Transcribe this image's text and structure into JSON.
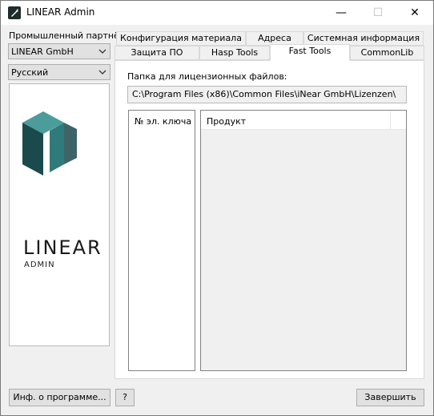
{
  "window": {
    "title": "LINEAR Admin",
    "minimize": "—",
    "maximize": "☐",
    "close": "✕"
  },
  "sidebar": {
    "partner_label": "Промышленный партнёр",
    "partner_value": "LINEAR GmbH",
    "language_value": "Русский",
    "logo": {
      "word": "LINEAR",
      "sub": "ADMIN",
      "colors": [
        "#1b4a4c",
        "#2f7a7b",
        "#4c9c9b"
      ]
    }
  },
  "tabs": {
    "row1": [
      "Конфигурация материала",
      "Адреса",
      "Системная информация"
    ],
    "row2": [
      "Защита ПО",
      "Hasp Tools",
      "Fast Tools",
      "CommonLib"
    ],
    "active": "Fast Tools"
  },
  "fast_tools": {
    "folder_label": "Папка для лицензионных файлов:",
    "folder_path": "C:\\Program Files (x86)\\Common Files\\iNear GmbH\\Lizenzen\\",
    "keys_header": "№ эл. ключа",
    "product_header": "Продукт"
  },
  "footer": {
    "about_button": "Инф. о программе...",
    "help_button": "?",
    "exit_button": "Завершить"
  }
}
